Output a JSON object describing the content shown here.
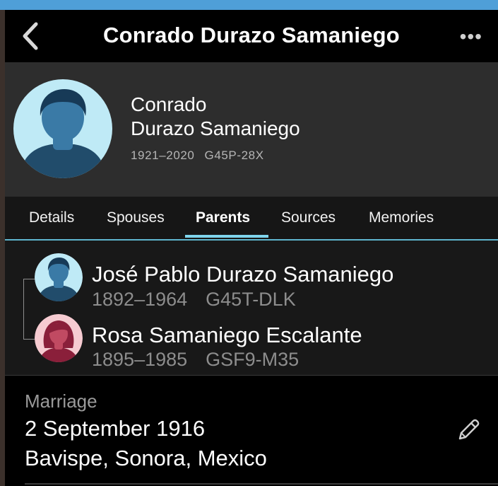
{
  "nav": {
    "title": "Conrado Durazo Samaniego",
    "more": "•••"
  },
  "person": {
    "given": "Conrado",
    "surname": "Durazo Samaniego",
    "lifespan": "1921–2020",
    "id": "G45P-28X"
  },
  "tabs": [
    {
      "label": "Details"
    },
    {
      "label": "Spouses"
    },
    {
      "label": "Parents"
    },
    {
      "label": "Sources"
    },
    {
      "label": "Memories"
    }
  ],
  "active_tab": "Parents",
  "parents": [
    {
      "name": "José Pablo Durazo Samaniego",
      "lifespan": "1892–1964",
      "id": "G45T-DLK",
      "avatar": "male-avatar-icon"
    },
    {
      "name": "Rosa Samaniego Escalante",
      "lifespan": "1895–1985",
      "id": "GSF9-M35",
      "avatar": "female-avatar-icon"
    }
  ],
  "marriage": {
    "label": "Marriage",
    "date": "2 September 1916",
    "place": "Bavispe, Sonora, Mexico"
  },
  "colors": {
    "accent": "#7fd4ec",
    "top_stripe": "#4f9fd8",
    "male_avatar_bg": "#bfeaf6",
    "female_avatar_bg": "#f6cbd1"
  }
}
